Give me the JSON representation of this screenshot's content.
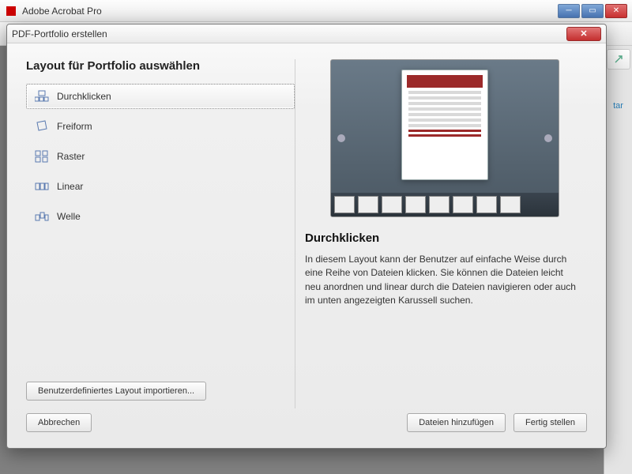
{
  "app": {
    "title": "Adobe Acrobat Pro"
  },
  "sidebar_hint": "tar",
  "dialog": {
    "title": "PDF-Portfolio erstellen",
    "heading": "Layout für Portfolio auswählen",
    "layouts": [
      {
        "label": "Durchklicken",
        "selected": true
      },
      {
        "label": "Freiform",
        "selected": false
      },
      {
        "label": "Raster",
        "selected": false
      },
      {
        "label": "Linear",
        "selected": false
      },
      {
        "label": "Welle",
        "selected": false
      }
    ],
    "import_button": "Benutzerdefiniertes Layout importieren...",
    "preview": {
      "title": "Durchklicken",
      "description": "In diesem Layout kann der Benutzer auf einfache Weise durch eine Reihe von Dateien klicken. Sie können die Dateien leicht neu anordnen und linear durch die Dateien navigieren oder auch im unten angezeigten Karussell suchen."
    },
    "buttons": {
      "cancel": "Abbrechen",
      "add_files": "Dateien hinzufügen",
      "finish": "Fertig stellen"
    }
  }
}
